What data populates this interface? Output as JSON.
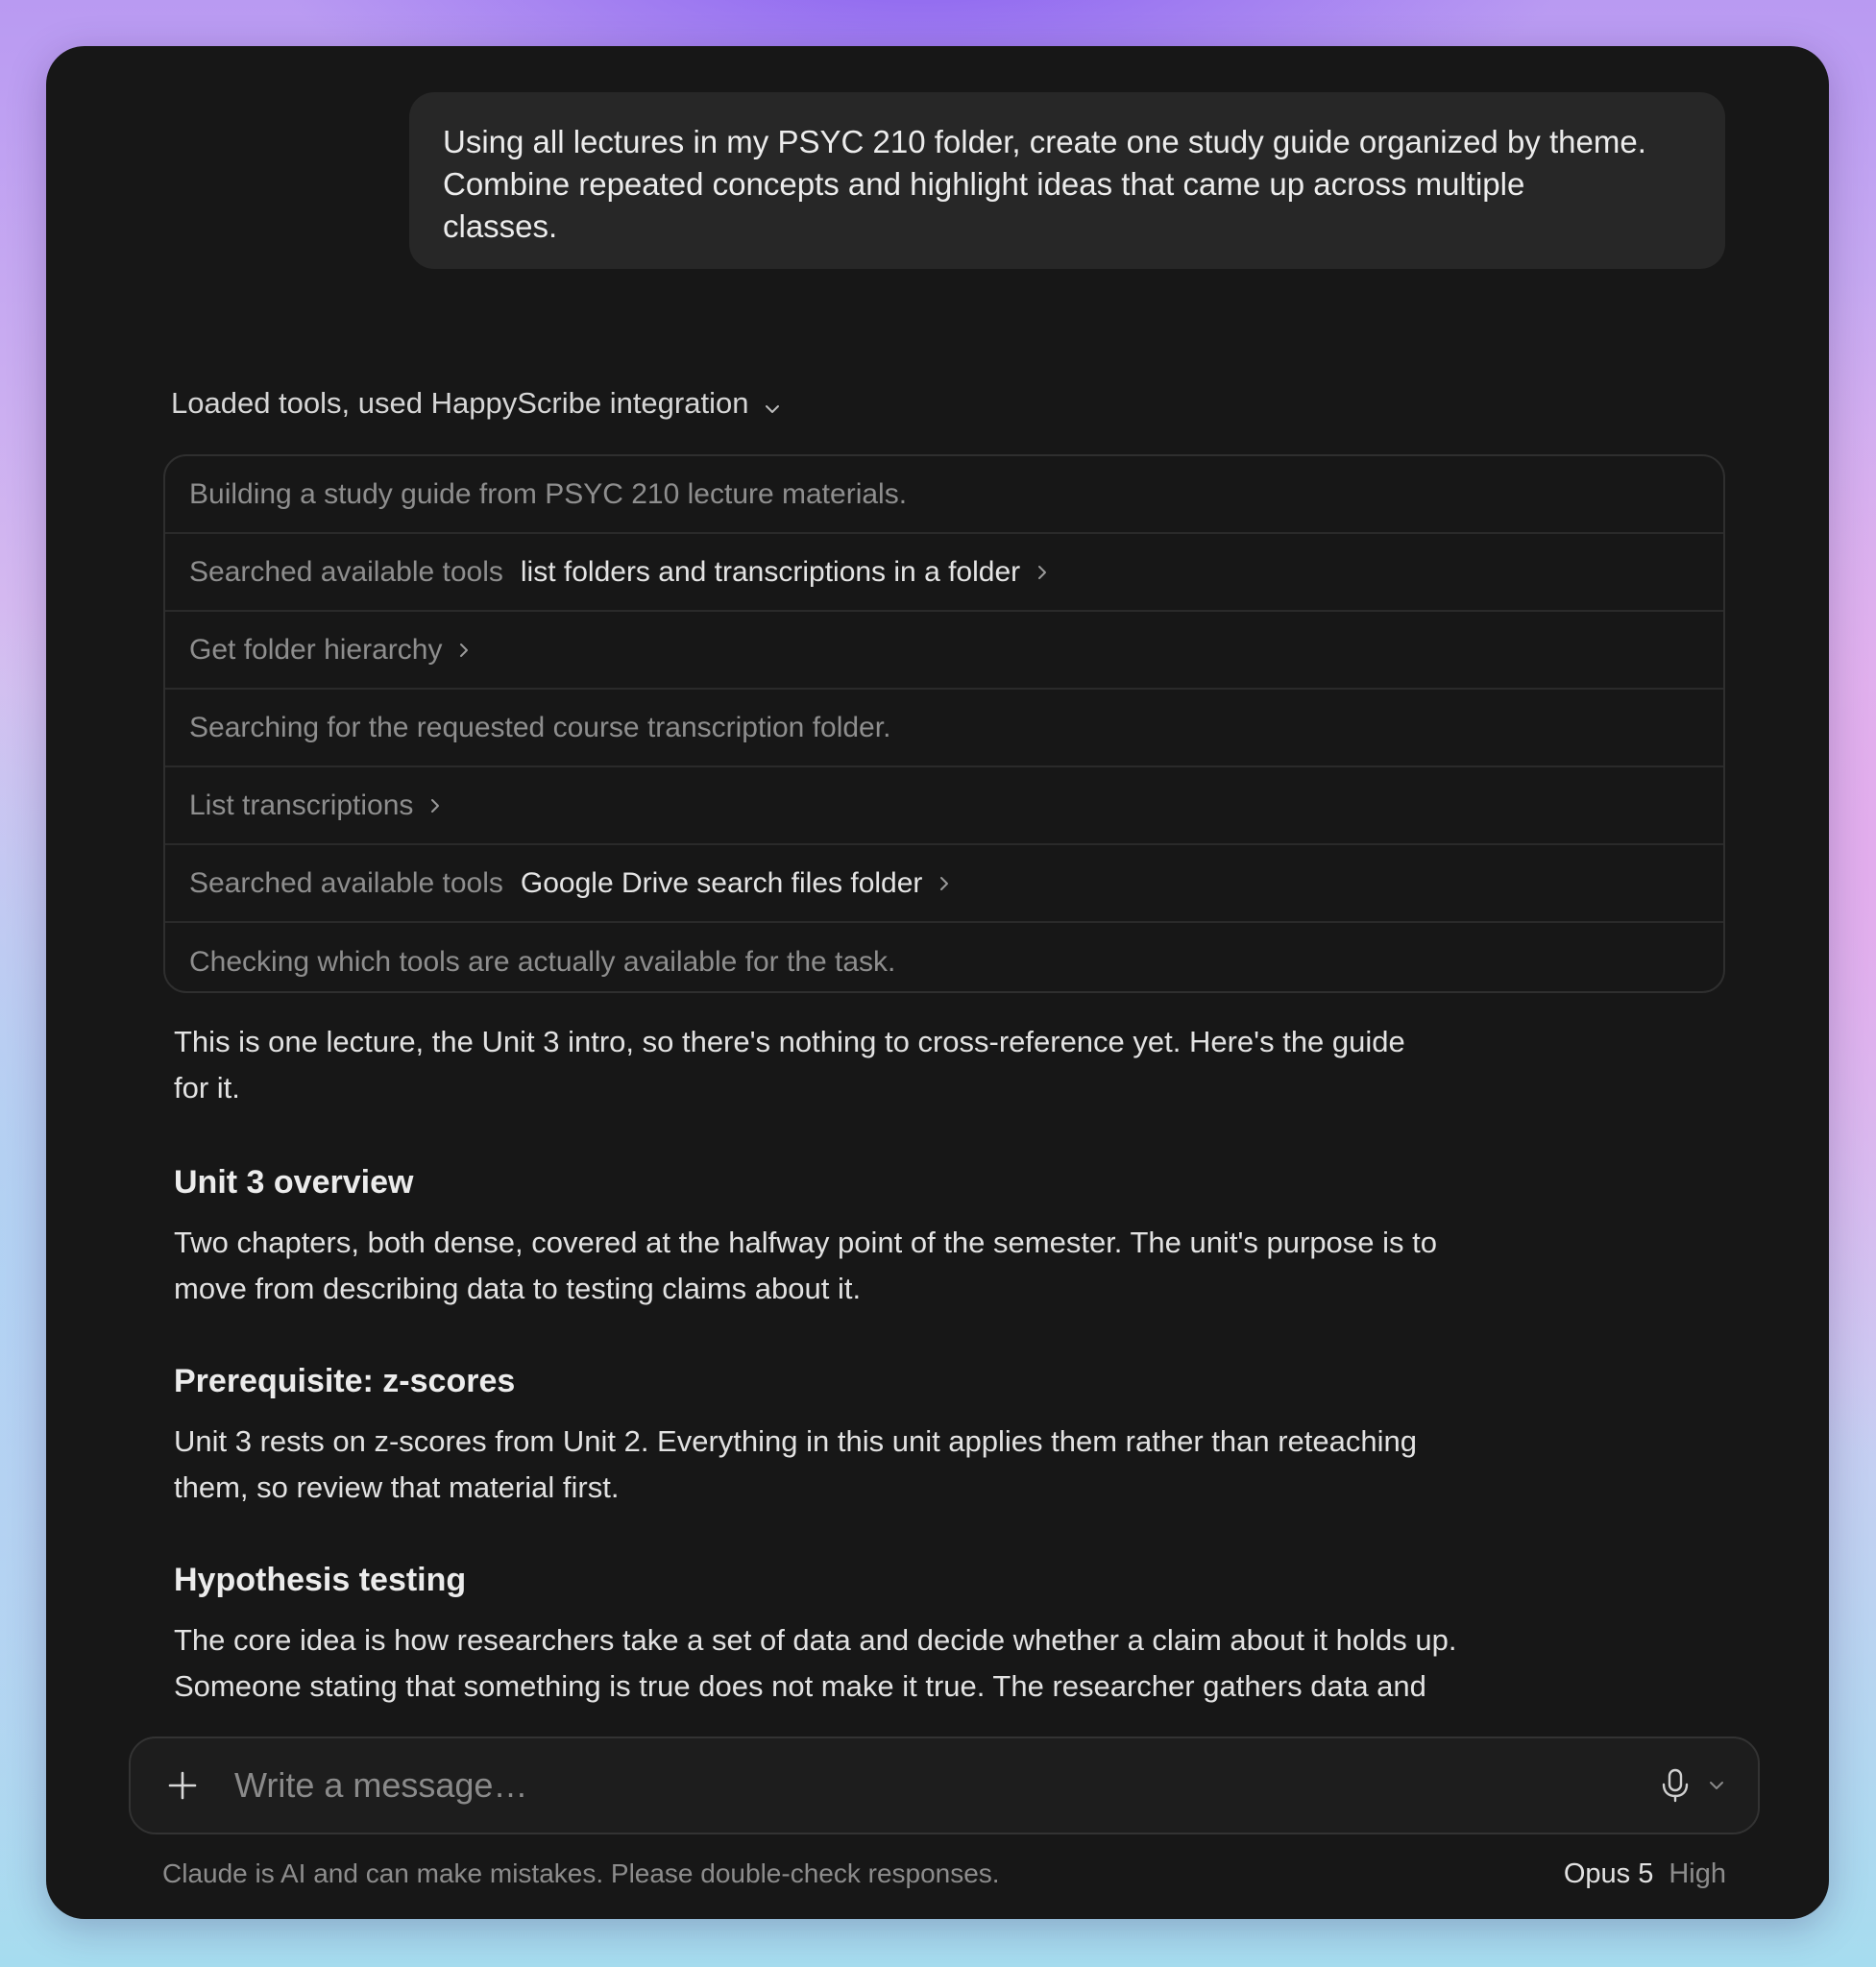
{
  "user_message": {
    "line1": "Using all lectures in my PSYC 210 folder, create one study guide organized by theme.",
    "line2": "Combine repeated concepts and highlight ideas that came up across multiple",
    "line3": "classes."
  },
  "tools": {
    "header": "Loaded tools, used HappyScribe integration",
    "rows": [
      {
        "text": "Building a study guide from PSYC 210 lecture materials."
      },
      {
        "text": "Searched available tools",
        "detail": "list folders and transcriptions in a folder"
      },
      {
        "text": "Get folder hierarchy"
      },
      {
        "text": "Searching for the requested course transcription folder."
      },
      {
        "text": "List transcriptions"
      },
      {
        "text": "Searched available tools",
        "detail": "Google Drive search files folder"
      },
      {
        "text": "Checking which tools are actually available for the task."
      }
    ]
  },
  "response": {
    "intro_line1": "This is one lecture, the Unit 3 intro, so there's nothing to cross-reference yet. Here's the guide",
    "intro_line2": "for it.",
    "sections": [
      {
        "heading": "Unit 3 overview",
        "line1": "Two chapters, both dense, covered at the halfway point of the semester. The unit's purpose is to",
        "line2": "move from describing data to testing claims about it."
      },
      {
        "heading": "Prerequisite: z-scores",
        "line1": "Unit 3 rests on z-scores from Unit 2. Everything in this unit applies them rather than reteaching",
        "line2": "them, so review that material first."
      },
      {
        "heading": "Hypothesis testing",
        "line1": "The core idea is how researchers take a set of data and decide whether a claim about it holds up.",
        "line2": "Someone stating that something is true does not make it true. The researcher gathers data and"
      }
    ]
  },
  "composer": {
    "placeholder": "Write a message…",
    "plus_icon": "plus-icon",
    "mic_icon": "microphone-icon"
  },
  "footer": {
    "disclaimer": "Claude is AI and can make mistakes. Please double-check responses.",
    "model": "Opus 5",
    "effort": "High"
  }
}
